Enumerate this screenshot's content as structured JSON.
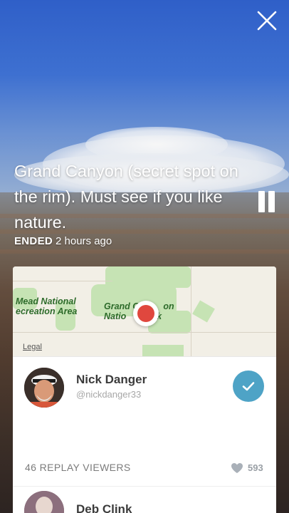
{
  "broadcast": {
    "caption": "Grand Canyon (secret spot on the rim).  Must see if you like nature.",
    "status_label": "ENDED",
    "time_ago": "2 hours ago"
  },
  "map": {
    "labels": {
      "lake_mead_line1": "Mead National",
      "lake_mead_line2": "ecreation Area",
      "grand_canyon_line1": "Grand C",
      "grand_canyon_line1b": "on",
      "grand_canyon_line2": "Natio",
      "grand_canyon_line2b": "rk"
    },
    "legal": "Legal"
  },
  "broadcaster": {
    "name": "Nick Danger",
    "handle": "@nickdanger33",
    "following": true
  },
  "stats": {
    "replay_viewers": "46 REPLAY VIEWERS",
    "hearts": "593"
  },
  "viewers": [
    {
      "name": "Deb Clink"
    }
  ],
  "colors": {
    "accent": "#4ea3c6",
    "pin": "#e0473e",
    "park": "#c6e3b4"
  },
  "icons": [
    "close-icon",
    "pause-icon",
    "checkmark-icon",
    "heart-icon",
    "map-pin-icon"
  ]
}
